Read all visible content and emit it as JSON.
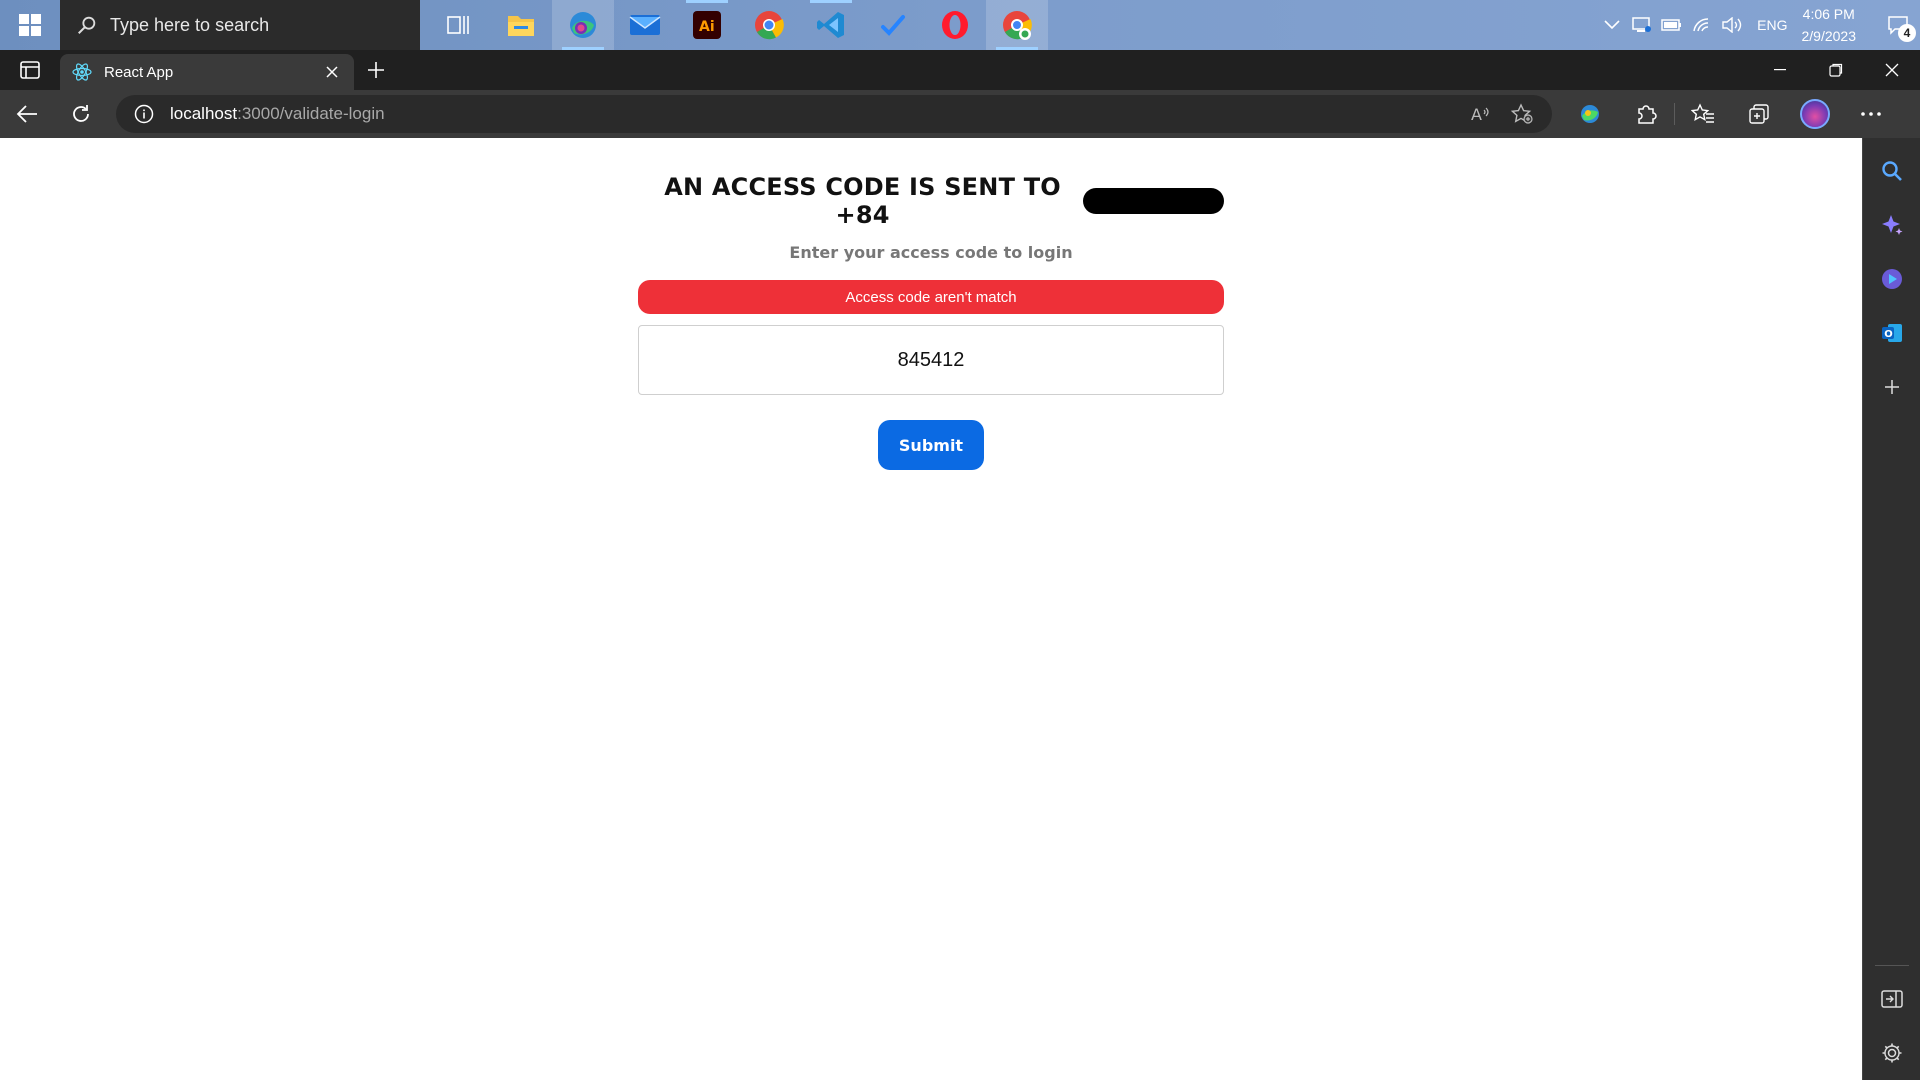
{
  "taskbar": {
    "search_placeholder": "Type here to search",
    "apps": [
      "task-view",
      "file-explorer",
      "edge",
      "mail",
      "illustrator",
      "chrome",
      "vscode",
      "jira",
      "opera",
      "chrome-profile"
    ],
    "tray": {
      "language": "ENG",
      "time": "4:06 PM",
      "date": "2/9/2023",
      "notification_count": "4"
    }
  },
  "browser": {
    "tab": {
      "title": "React App",
      "icon": "react-icon"
    },
    "address": {
      "host": "localhost",
      "path": ":3000/validate-login"
    }
  },
  "page": {
    "heading": "AN ACCESS CODE IS SENT TO +84",
    "subtitle": "Enter your access code to login",
    "error_message": "Access code aren't match",
    "code_value": "845412",
    "submit_label": "Submit"
  },
  "colors": {
    "error_bg": "#ee3038",
    "submit_bg": "#0b6ae3",
    "subtitle": "#777777"
  }
}
